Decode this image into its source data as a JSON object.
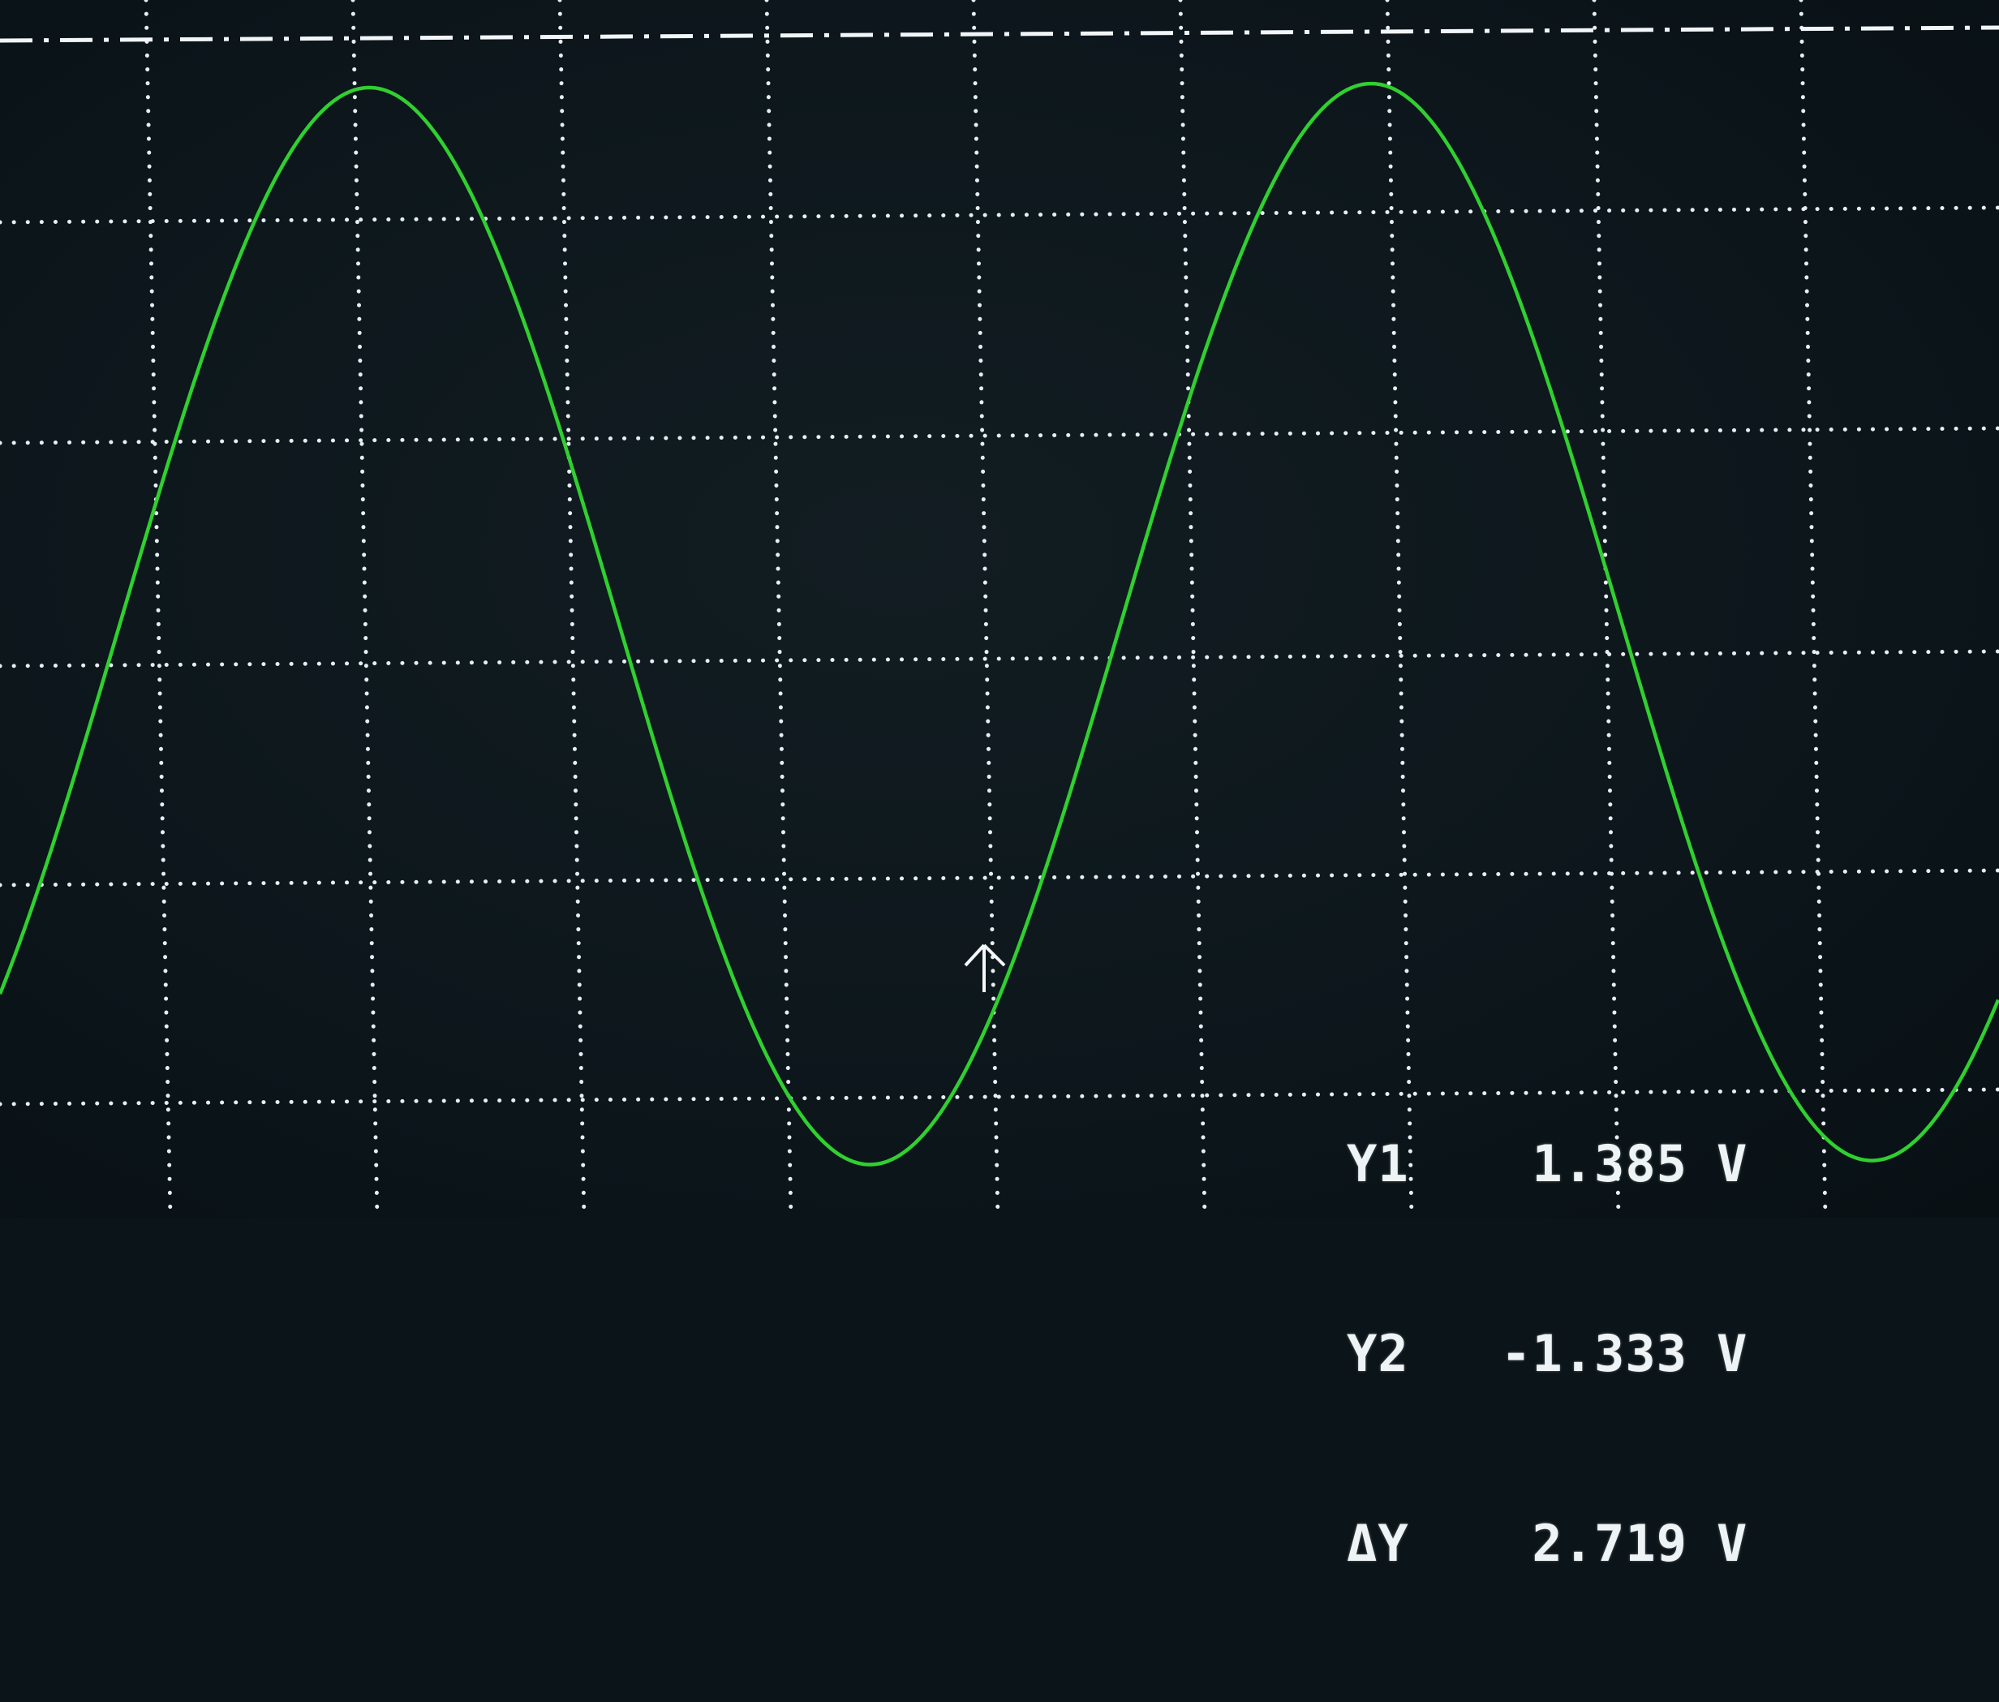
{
  "screen": {
    "background": "#0c161b",
    "grid_color": "#e6eef2",
    "trace_color": "#2fd02f",
    "grid": {
      "vertical_divisions": 10,
      "horizontal_divisions": 6
    }
  },
  "trace": {
    "name": "",
    "waveform": "sine",
    "cycles_visible": 2.0
  },
  "cursor": {
    "icon": "up-arrow-cursor-icon",
    "reference_line": "dash-dot"
  },
  "readouts": [
    {
      "label": "Y1",
      "value": "1.385",
      "unit": "V"
    },
    {
      "label": "Y2",
      "value": "-1.333",
      "unit": "V"
    },
    {
      "label": "ΔY",
      "value": "2.719",
      "unit": "V"
    }
  ]
}
